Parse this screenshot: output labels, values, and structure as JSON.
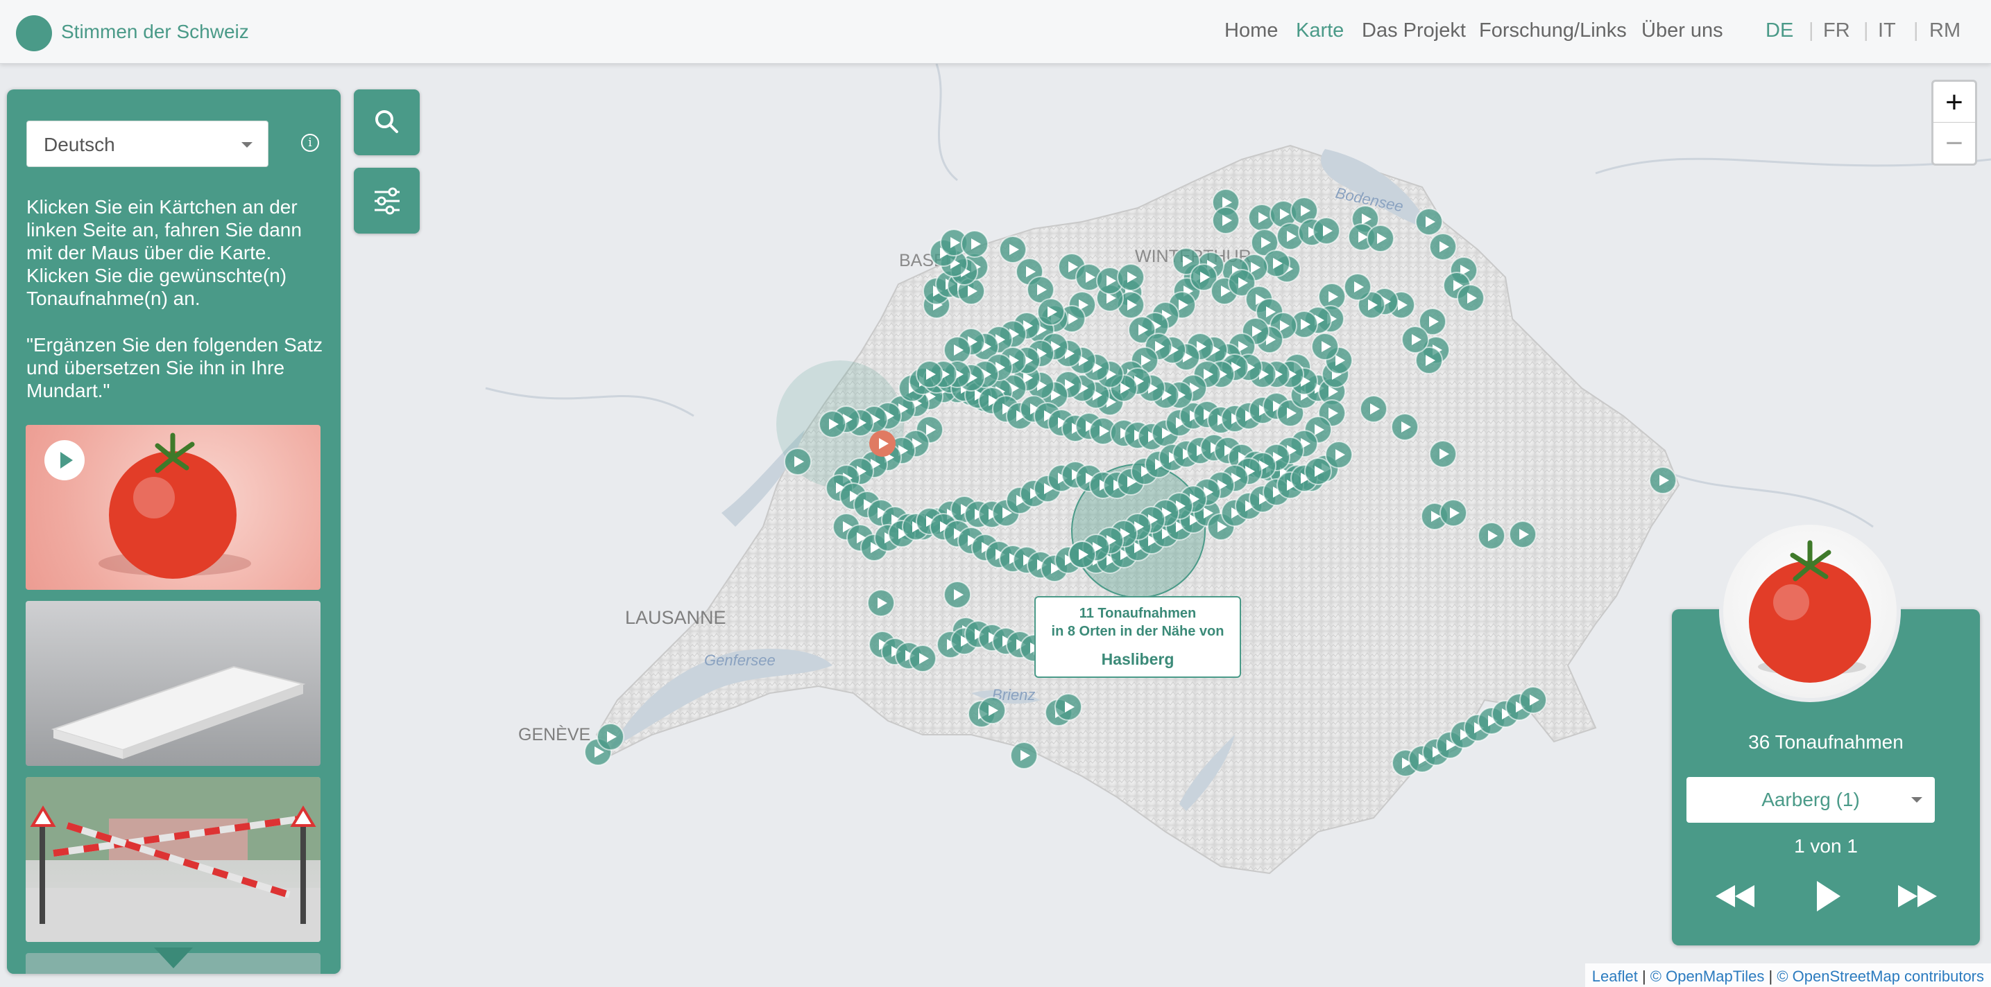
{
  "header": {
    "brand": "Stimmen der Schweiz",
    "nav": [
      "Home",
      "Karte",
      "Das Projekt",
      "Forschung/Links",
      "Über uns"
    ],
    "nav_active": "Karte",
    "languages": [
      "DE",
      "FR",
      "IT",
      "RM"
    ],
    "language_active": "DE"
  },
  "sidebar": {
    "language_select": "Deutsch",
    "instructions": "Klicken Sie ein Kärtchen an der linken Seite an, fahren Sie dann mit der Maus über die Karte. Klicken Sie die gewünschte(n) Tonaufnahme(n) an.",
    "prompt": "\"Ergänzen Sie den folgenden Satz und übersetzen Sie ihn in Ihre Mundart.\"",
    "cards": [
      "tomato",
      "mattress",
      "railway-crossing"
    ]
  },
  "map": {
    "labels": [
      "BASEL",
      "WINTERTHUR",
      "LAUSANNE",
      "GENÈVE",
      "Bodensee",
      "Genfersee",
      "Brienz"
    ],
    "tooltip": {
      "line1": "11 Tonaufnahmen",
      "line2": "in 8 Orten in der Nähe von",
      "place": "Hasliberg"
    },
    "attribution": [
      "Leaflet",
      "© OpenMapTiles",
      "© OpenStreetMap contributors"
    ]
  },
  "player": {
    "count": "36 Tonaufnahmen",
    "place_select": "Aarberg (1)",
    "pager": "1 von 1"
  },
  "colors": {
    "accent": "#4a9a88",
    "marker": "#4a9a88",
    "active_marker": "#e07a62"
  }
}
